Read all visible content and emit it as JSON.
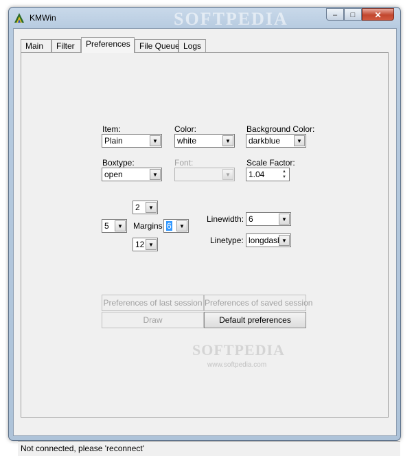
{
  "window": {
    "title": "KMWin",
    "watermark": "SOFTPEDIA",
    "minimize": "–",
    "maximize": "□",
    "close": "✕"
  },
  "tabs": [
    "Main",
    "Filter",
    "Preferences",
    "File Queue",
    "Logs"
  ],
  "active_tab": "Preferences",
  "preferences": {
    "item": {
      "label": "Item:",
      "value": "Plain"
    },
    "color": {
      "label": "Color:",
      "value": "white"
    },
    "background_color": {
      "label": "Background Color:",
      "value": "darkblue"
    },
    "boxtype": {
      "label": "Boxtype:",
      "value": "open"
    },
    "font": {
      "label": "Font:",
      "value": ""
    },
    "scale_factor": {
      "label": "Scale Factor:",
      "value": "1.04"
    },
    "margins": {
      "label": "Margins",
      "top": "2",
      "left": "5",
      "right": "6",
      "bottom": "12"
    },
    "linewidth": {
      "label": "Linewidth:",
      "value": "6"
    },
    "linetype": {
      "label": "Linetype:",
      "value": "longdash"
    }
  },
  "buttons": {
    "last_session": "Preferences of last session",
    "saved_session": "Preferences of saved session",
    "draw": "Draw",
    "default": "Default preferences"
  },
  "content_watermark": "SOFTPEDIA",
  "content_watermark_url": "www.softpedia.com",
  "status": "Not connected, please 'reconnect'"
}
